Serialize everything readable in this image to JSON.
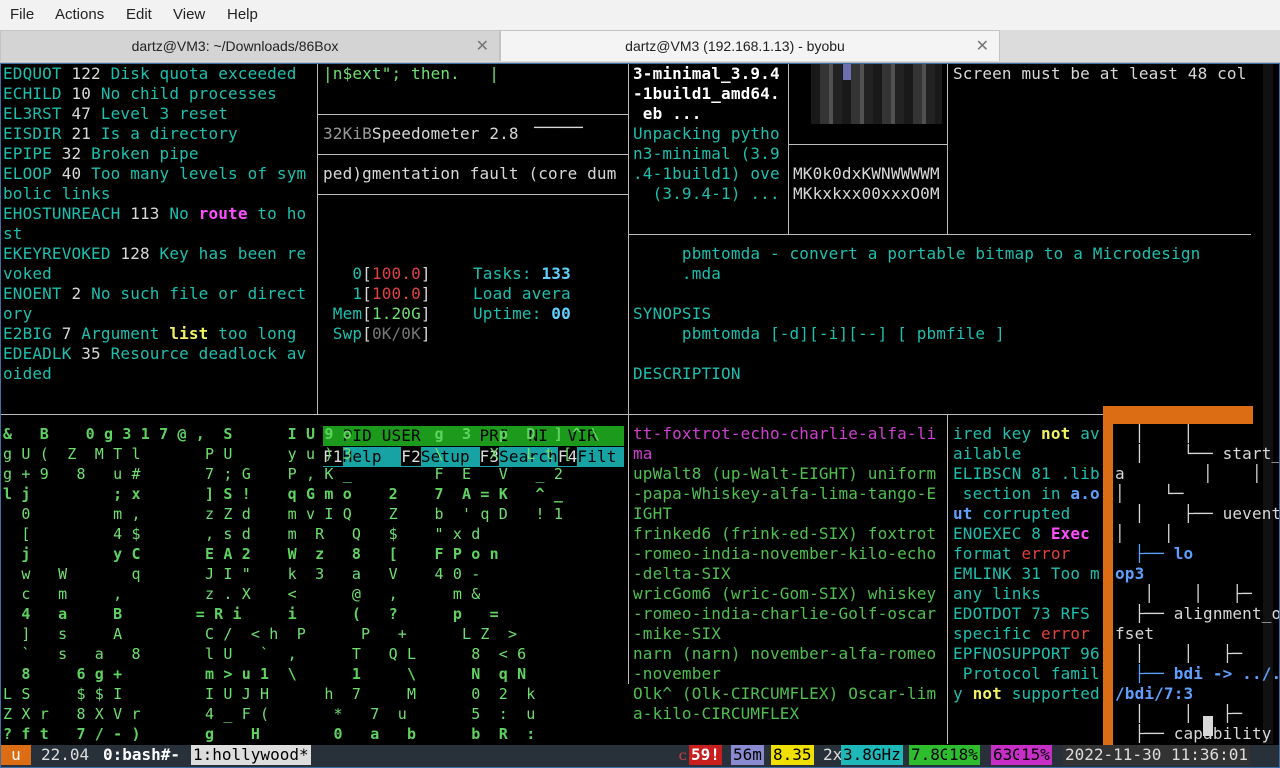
{
  "menubar": {
    "items": [
      "File",
      "Actions",
      "Edit",
      "View",
      "Help"
    ]
  },
  "tabs": [
    {
      "title": "dartz@VM3: ~/Downloads/86Box",
      "close": "✕"
    },
    {
      "title": "dartz@VM3 (192.168.1.13) - byobu",
      "close": "✕"
    }
  ],
  "errno_pane": {
    "lines": [
      [
        "EDQUOT",
        " 122 ",
        "Disk quota exceeded"
      ],
      [
        "ECHILD",
        " 10 ",
        "No child processes"
      ],
      [
        "EL3RST",
        " 47 ",
        "Level 3 reset"
      ],
      [
        "EISDIR",
        " 21 ",
        "Is a directory"
      ],
      [
        "EPIPE",
        " 32 ",
        "Broken pipe"
      ],
      [
        "ELOOP",
        " 40 ",
        "Too many levels of sym"
      ],
      [
        "",
        "",
        "bolic links"
      ],
      [
        "EHOSTUNREACH",
        " 113 ",
        "No route to ho"
      ],
      [
        "",
        "",
        "st"
      ],
      [
        "EKEYREVOKED",
        " 128 ",
        "Key has been re"
      ],
      [
        "",
        "",
        "voked"
      ],
      [
        "ENOENT",
        " 2 ",
        "No such file or direct"
      ],
      [
        "",
        "",
        "ory"
      ],
      [
        "E2BIG",
        " 7 ",
        "Argument list too long"
      ],
      [
        "EDEADLK",
        " 35 ",
        "Resource deadlock av"
      ],
      [
        "",
        "",
        "oided"
      ]
    ]
  },
  "code_pane": {
    "line1": "|n$ext\"; then.   |"
  },
  "speedometer_pane": {
    "size": "32KiB",
    "label": "Speedometer 2.8",
    "dash": "─────"
  },
  "segfault_pane": {
    "text": "ped)gmentation fault (core dum"
  },
  "htop": {
    "cpu0_label": "0",
    "cpu0_value": "100.0",
    "cpu1_label": "1",
    "cpu1_value": "100.0",
    "mem_label": "Mem",
    "mem_value": "1.20G",
    "swp_label": "Swp",
    "swp_value": "0K/0K",
    "tasks_label": "Tasks:",
    "tasks_value": "133",
    "load_label": "Load avera",
    "uptime_label": "Uptime:",
    "uptime_value": "00",
    "header": "  PID USER      PRI  NI  VIR",
    "keys": [
      {
        "key": "F1",
        "label": "Help  "
      },
      {
        "key": "F2",
        "label": "Setup "
      },
      {
        "key": "F3",
        "label": "Search"
      },
      {
        "key": "F4",
        "label": "Filt"
      }
    ]
  },
  "apt_pane": {
    "lines": [
      "3-minimal_3.9.4",
      "-1build1_amd64.",
      " eb ...",
      "Unpacking pytho",
      "n3-minimal (3.9",
      ".4-1build1) ove",
      "  (3.9.4-1) ..."
    ]
  },
  "ascii_image_pane": {
    "line1": "MK0k0dxKWNWWWWM",
    "line2": "MKkxkxx00xxxO0M"
  },
  "screen_msg": {
    "text": "Screen must be at least 48 col"
  },
  "manpage": {
    "title_line": "     pbmtomda - convert a portable bitmap to a Microdesign",
    "title_cont": "     .mda",
    "synopsis_heading": "SYNOPSIS",
    "synopsis": "     pbmtomda [-d][-i][--] [ pbmfile ]",
    "description_heading": "DESCRIPTION"
  },
  "matrix_rain": {
    "lines": [
      "&   B    0 g 3 1 7 @ ,  S      I U 9 o         g  3   p  D  ] ^ \\",
      "g U (  Z  M T l       P U      y u ) 3         \\     X   L t [",
      "g + 9   8   u #       7 ; G    P , K _         F  E   V   _ 2",
      "l j         ; x       ] S !    q G m o    2    7  A = K   ^ _",
      "  0         m ,       z Z d    m v I Q    Z    b  ' q D   ! 1",
      "  [         4 $       , s d    m  R   Q   $    \" x d",
      "  j         y C       E A 2    W  z   8   [    F P o n",
      "  w   W       q       J I \"    k  3   a   V    4 0 -",
      "  c   m     ,         z . X    <      @   ,      m &",
      "  4   a     B        = R i     i      (   ?      p   =",
      "  ]   s     A         C /  < h  P      P   +      L Z  >",
      "  `   s   a   8       l U   `  ,      T   Q L      8  < 6",
      "  8     6 g +         m > u 1  \\      1     \\      N  q N",
      "L S     $ $ I         I U J H      h  7     M      0  2  k",
      "Z X r   8 X V r       4 _ F (       *   7  u       5  :  u",
      "? f t   7 / - )       g    H        0   a   b      b  R  :"
    ]
  },
  "nato_pane": {
    "lines": [
      "tt-foxtrot-echo-charlie-alfa-li",
      "ma",
      "upWalt8 (up-Walt-EIGHT) uniform",
      "-papa-Whiskey-alfa-lima-tango-E",
      "IGHT",
      "frinked6 (frink-ed-SIX) foxtrot",
      "-romeo-india-november-kilo-echo",
      "-delta-SIX",
      "wricGom6 (wric-Gom-SIX) whiskey",
      "-romeo-india-charlie-Golf-oscar",
      "-mike-SIX",
      "narn (narn) november-alfa-romeo",
      "-november",
      "Olk^ (Olk-CIRCUMFLEX) Oscar-lim",
      "a-kilo-CIRCUMFLEX"
    ]
  },
  "errno_pane2": {
    "lines": [
      "ired key not av",
      "ailable",
      "ELIBSCN 81 .lib",
      " section in a.o",
      "ut corrupted",
      "ENOEXEC 8 Exec",
      "format error",
      "EMLINK 31 Too m",
      "any links",
      "EDOTDOT 73 RFS",
      "specific error",
      "EPFNOSUPPORT 96",
      " Protocol famil",
      "y not supported"
    ]
  },
  "tree_pane": {
    "lines": [
      "  │    │",
      "  │    └── start_lb",
      "a        │    │",
      "│    └─",
      "  │    ├── uevent",
      "│    │",
      "  ├── lo",
      "op3",
      "   │    │   ├─",
      "  ├── alignment_of",
      "fset",
      "  │    │   ├─",
      "  ├── bdi -> ../..",
      "/bdi/7:3",
      "  │    │   ├─",
      "  ├── capability"
    ]
  },
  "statusbar": {
    "logo": "u",
    "version": "22.04",
    "win0": "0:bash#-",
    "win1": "1:hollywood*",
    "alert": "59!",
    "uptime": "56m",
    "load": "8.35",
    "cpu_count": "2x",
    "cpu_freq": "3.8GHz",
    "mem_total": "7.8G",
    "mem_pct": "18%",
    "disk_total": "63G",
    "disk_pct": "15%",
    "datetime": "2022-11-30 11:36:01"
  }
}
